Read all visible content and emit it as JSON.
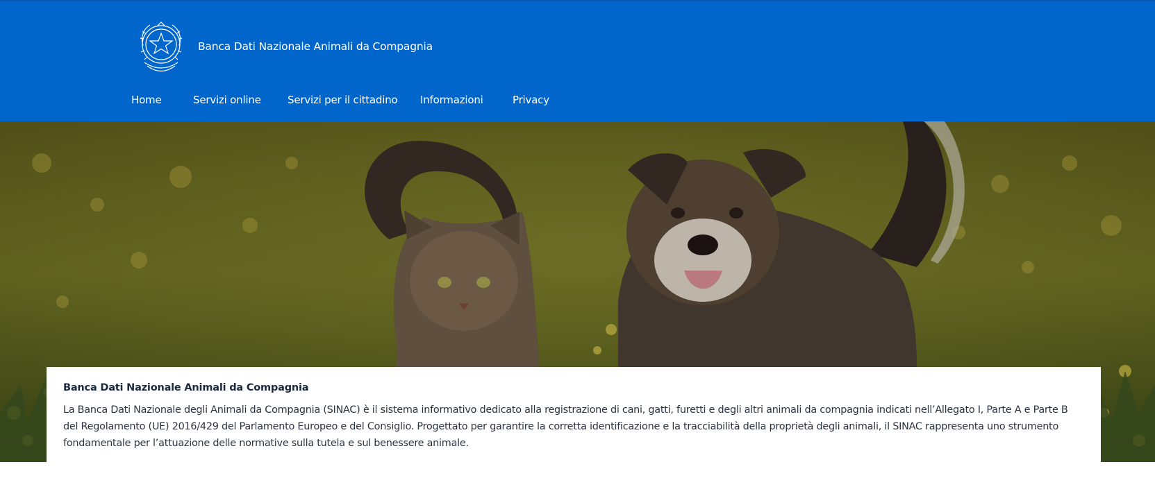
{
  "header": {
    "site_title": "Banca Dati Nazionale Animali da Compagnia",
    "emblem": "italian-republic-emblem",
    "background": "#0066cc"
  },
  "nav": {
    "items": [
      {
        "label": "Home"
      },
      {
        "label": "Servizi online"
      },
      {
        "label": "Servizi per il cittadino"
      },
      {
        "label": "Informazioni"
      },
      {
        "label": "Privacy"
      }
    ]
  },
  "hero": {
    "image": "cat-and-dog-in-meadow"
  },
  "intro": {
    "title": "Banca Dati Nazionale Animali da Compagnia",
    "body": "La Banca Dati Nazionale degli Animali da Compagnia (SINAC) è il sistema informativo dedicato alla registrazione di cani, gatti, furetti e degli altri animali da compagnia indicati nell’Allegato I, Parte A e Parte B del Regolamento (UE) 2016/429 del Parlamento Europeo e del Consiglio. Progettato per garantire la corretta identificazione e la tracciabilità della proprietà degli animali, il SINAC rappresenta uno strumento fondamentale per l’attuazione delle normative sulla tutela e sul benessere animale."
  }
}
